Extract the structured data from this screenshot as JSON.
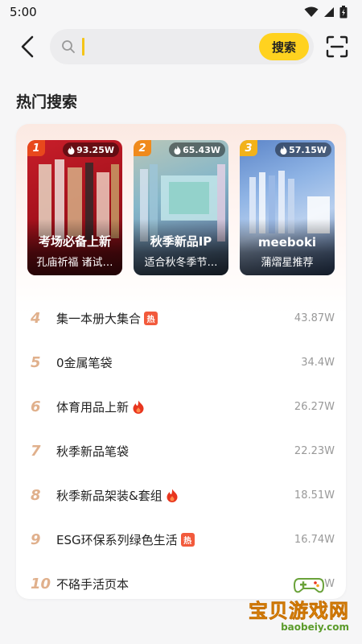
{
  "status": {
    "time": "5:00"
  },
  "search": {
    "value": "",
    "placeholder": "",
    "button_label": "搜索"
  },
  "section_title": "热门搜索",
  "top3": [
    {
      "rank": "1",
      "heat": "93.25W",
      "title": "考场必备上新",
      "subtitle": "孔庙祈福 诸试…"
    },
    {
      "rank": "2",
      "heat": "65.43W",
      "title": "秋季新品IP",
      "subtitle": "适合秋冬季节…"
    },
    {
      "rank": "3",
      "heat": "57.15W",
      "title": "meeboki",
      "subtitle": "蒲熠星推荐"
    }
  ],
  "list": [
    {
      "rank": "4",
      "title": "集一本册大集合",
      "tag": "热",
      "heat": "43.87W"
    },
    {
      "rank": "5",
      "title": "0金属笔袋",
      "tag": "",
      "heat": "34.4W"
    },
    {
      "rank": "6",
      "title": "体育用品上新",
      "tag": "flame",
      "heat": "26.27W"
    },
    {
      "rank": "7",
      "title": "秋季新品笔袋",
      "tag": "",
      "heat": "22.23W"
    },
    {
      "rank": "8",
      "title": "秋季新品架装&套组",
      "tag": "flame",
      "heat": "18.51W"
    },
    {
      "rank": "9",
      "title": "ESG环保系列绿色生活",
      "tag": "热",
      "heat": "16.74W"
    },
    {
      "rank": "10",
      "title": "不硌手活页本",
      "tag": "",
      "heat": "9.49W"
    }
  ],
  "watermark": {
    "title": "宝贝游戏网",
    "url": "baobeiy.com"
  },
  "colors": {
    "accent": "#ffd21f",
    "hot_tag": "#f25a3c",
    "rank_text": "#e0b08c"
  }
}
